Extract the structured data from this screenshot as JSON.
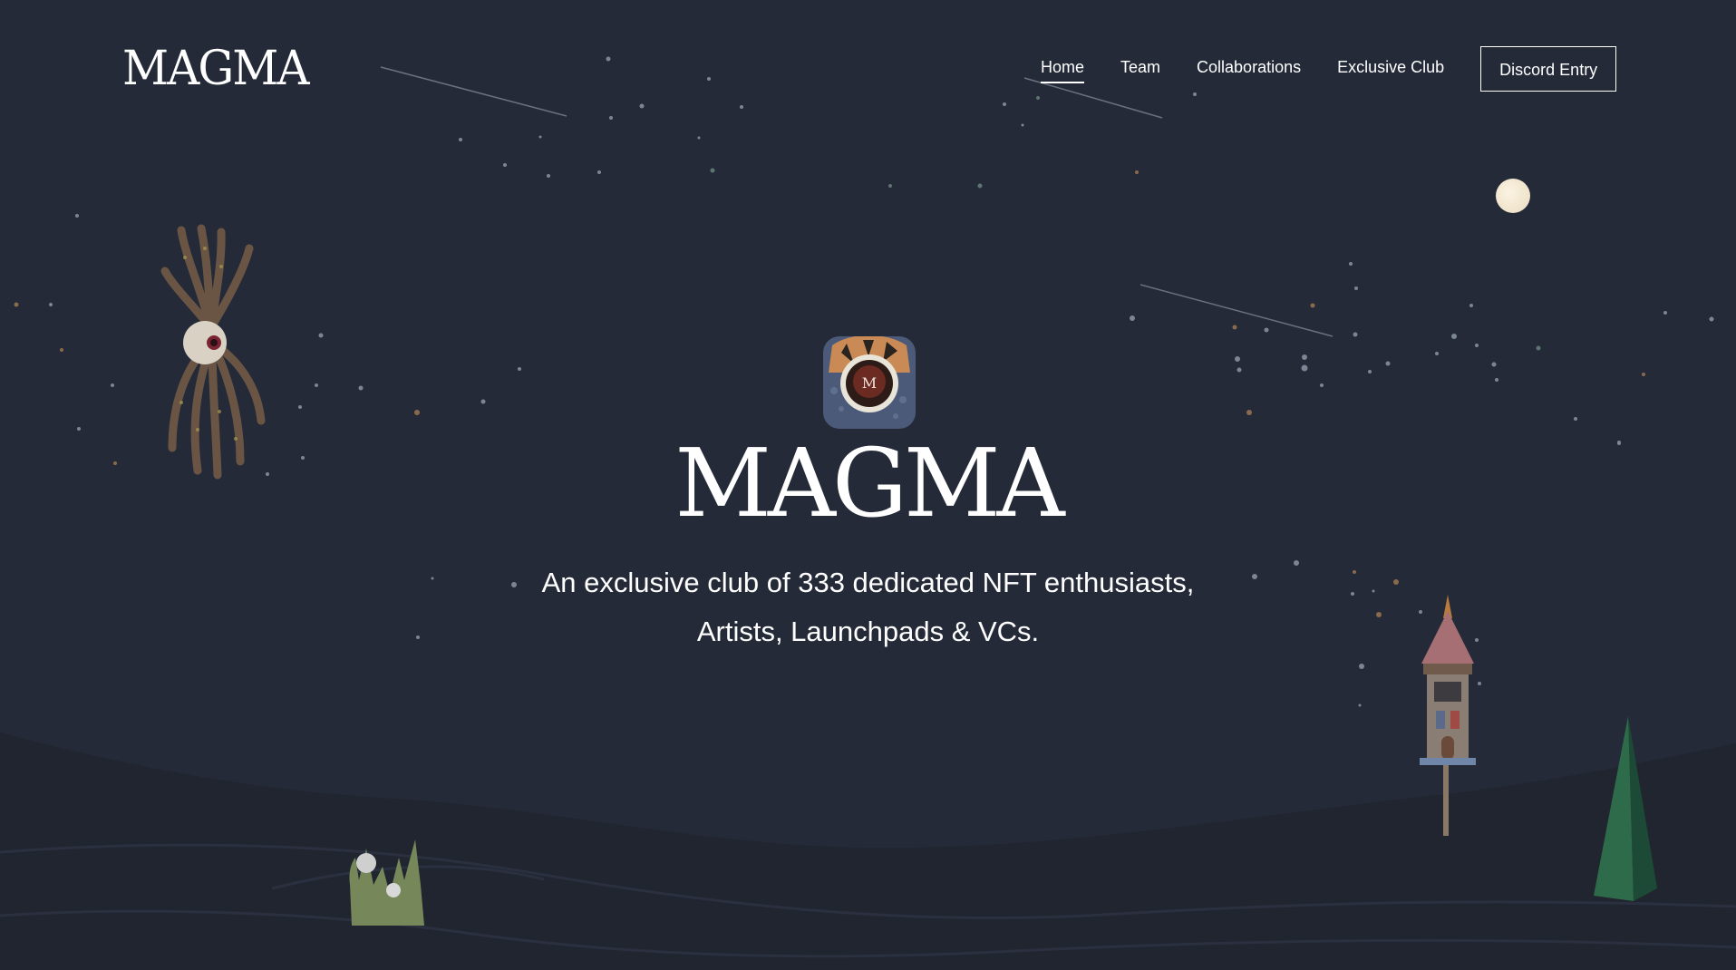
{
  "header": {
    "logo_text": "MAGMA",
    "nav": [
      {
        "label": "Home",
        "active": true
      },
      {
        "label": "Team",
        "active": false
      },
      {
        "label": "Collaborations",
        "active": false
      },
      {
        "label": "Exclusive Club",
        "active": false
      }
    ],
    "cta_label": "Discord Entry"
  },
  "hero": {
    "badge_letter": "M",
    "title": "MAGMA",
    "tagline_line1": "An exclusive club of 333 dedicated NFT enthusiasts,",
    "tagline_line2": "Artists, Launchpads & VCs."
  },
  "colors": {
    "background": "#242a38",
    "hills": "#20252f",
    "text": "#ffffff"
  },
  "icons": [
    "moon-icon",
    "shooting-star",
    "eye-creature-illustration",
    "coral-illustration",
    "tower-illustration",
    "crystal-illustration",
    "magma-badge-icon"
  ]
}
